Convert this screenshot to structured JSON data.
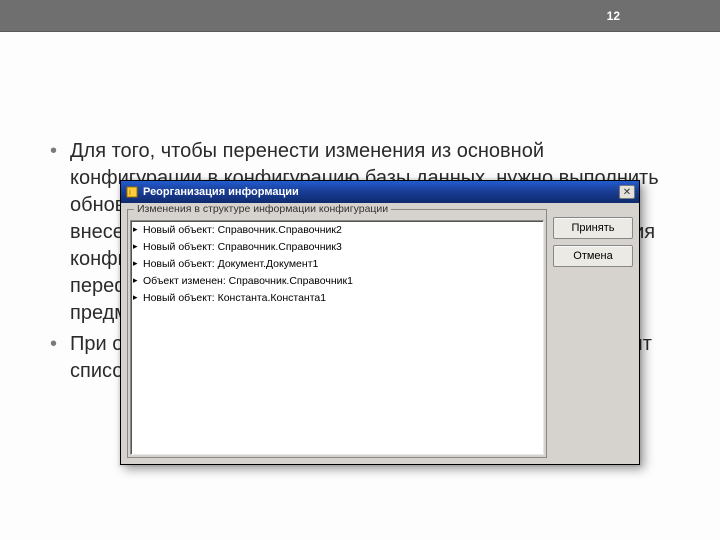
{
  "page_number": "12",
  "bullets": [
    "Для того, чтобы перенести изменения из основной конфигурации в конфигурацию базы данных, нужно выполнить обновление конфигурации базы данных. При этом будут внесены изменения, сделанные после последнего сохранения конфигурации. После обновления система переформировывает структуру БД в соответствии с предметной областью.",
    "При обновлении конфигурации базы данных система выводит список изменений, которые будут внесены."
  ],
  "dialog": {
    "title": "Реорганизация информации",
    "group_label": "Изменения в структуре информации конфигурации",
    "items": [
      "Новый объект: Справочник.Справочник2",
      "Новый объект: Справочник.Справочник3",
      "Новый объект: Документ.Документ1",
      "Объект изменен: Справочник.Справочник1",
      "Новый объект: Константа.Константа1"
    ],
    "accept_label": "Принять",
    "cancel_label": "Отмена"
  }
}
